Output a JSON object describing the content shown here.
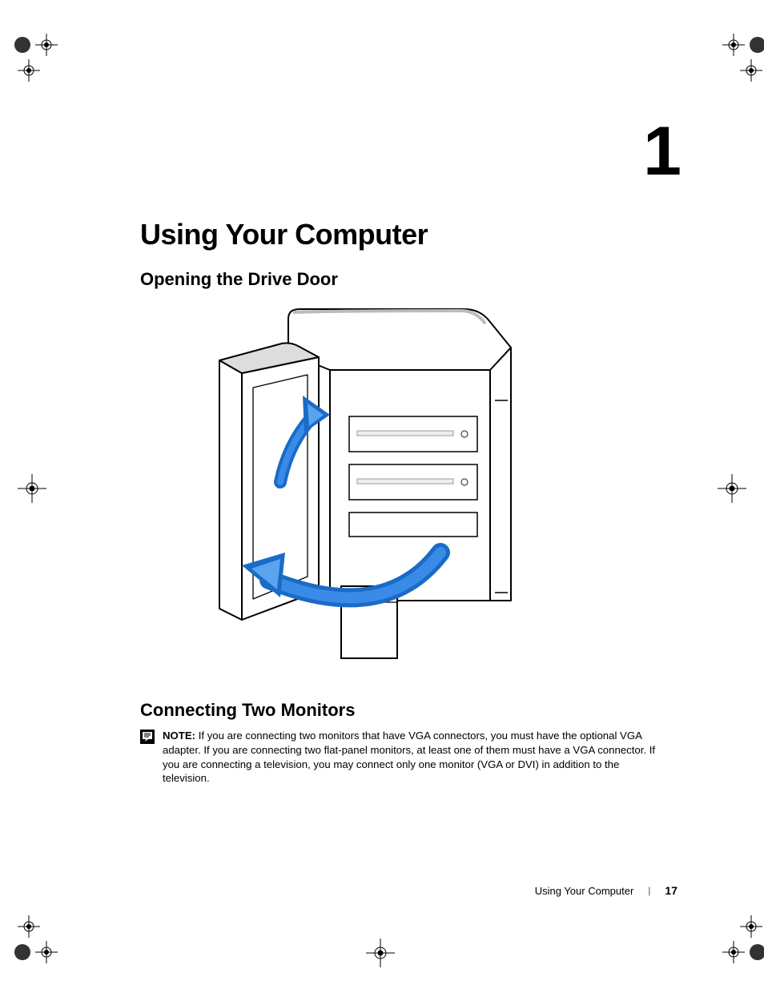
{
  "chapter": {
    "number": "1",
    "title": "Using Your Computer"
  },
  "sections": {
    "drive_door": "Opening the Drive Door",
    "two_monitors": "Connecting Two Monitors"
  },
  "note": {
    "label": "NOTE:",
    "body": "If you are connecting two monitors that have VGA connectors, you must have the optional VGA adapter. If you are connecting two flat-panel monitors, at least one of them must have a VGA connector. If you are connecting a television, you may connect only one monitor (VGA or DVI) in addition to the television."
  },
  "footer": {
    "section": "Using Your Computer",
    "page": "17"
  }
}
